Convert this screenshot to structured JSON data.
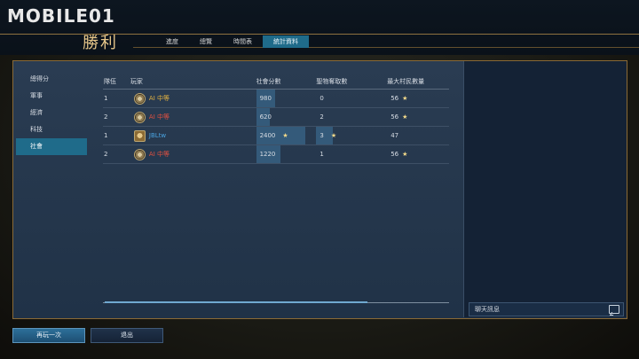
{
  "brand": {
    "logo": "MOBILE01"
  },
  "header": {
    "title": "勝利",
    "tabs": [
      {
        "label": "進度",
        "active": false
      },
      {
        "label": "總覽",
        "active": false
      },
      {
        "label": "時間表",
        "active": false
      },
      {
        "label": "統計資料",
        "active": true
      }
    ]
  },
  "sidebar": {
    "items": [
      {
        "label": "總得分",
        "active": false
      },
      {
        "label": "軍事",
        "active": false
      },
      {
        "label": "經濟",
        "active": false
      },
      {
        "label": "科技",
        "active": false
      },
      {
        "label": "社會",
        "active": true
      }
    ]
  },
  "table": {
    "headers": {
      "team": "隊伍",
      "player": "玩家",
      "social": "社會分數",
      "relics": "聖物奪取數",
      "maxpop": "最大村民數量"
    },
    "rows": [
      {
        "team": "1",
        "player": "AI 中等",
        "player_type": "ai-yellow",
        "social": "980",
        "social_fill": 0.35,
        "social_star": false,
        "relics": "0",
        "relics_fill": 0,
        "relics_star": false,
        "maxpop": "56",
        "maxpop_star": true
      },
      {
        "team": "2",
        "player": "AI 中等",
        "player_type": "ai-red",
        "social": "620",
        "social_fill": 0.25,
        "social_star": false,
        "relics": "2",
        "relics_fill": 0,
        "relics_star": false,
        "maxpop": "56",
        "maxpop_star": true
      },
      {
        "team": "1",
        "player": "JBLtw",
        "player_type": "human",
        "social": "2400",
        "social_fill": 0.9,
        "social_star": true,
        "relics": "3",
        "relics_fill": 0.3,
        "relics_star": true,
        "maxpop": "47",
        "maxpop_star": false
      },
      {
        "team": "2",
        "player": "AI 中等",
        "player_type": "ai-red",
        "social": "1220",
        "social_fill": 0.45,
        "social_star": false,
        "relics": "1",
        "relics_fill": 0,
        "relics_star": false,
        "maxpop": "56",
        "maxpop_star": true
      }
    ]
  },
  "chat": {
    "label": "聊天訊息",
    "icon": "chat-bubble-icon"
  },
  "buttons": {
    "replay": "再玩一次",
    "exit": "退出"
  },
  "colors": {
    "accent": "#1f6b8a",
    "gold": "#b08a4a",
    "star": "#f2d98a"
  }
}
